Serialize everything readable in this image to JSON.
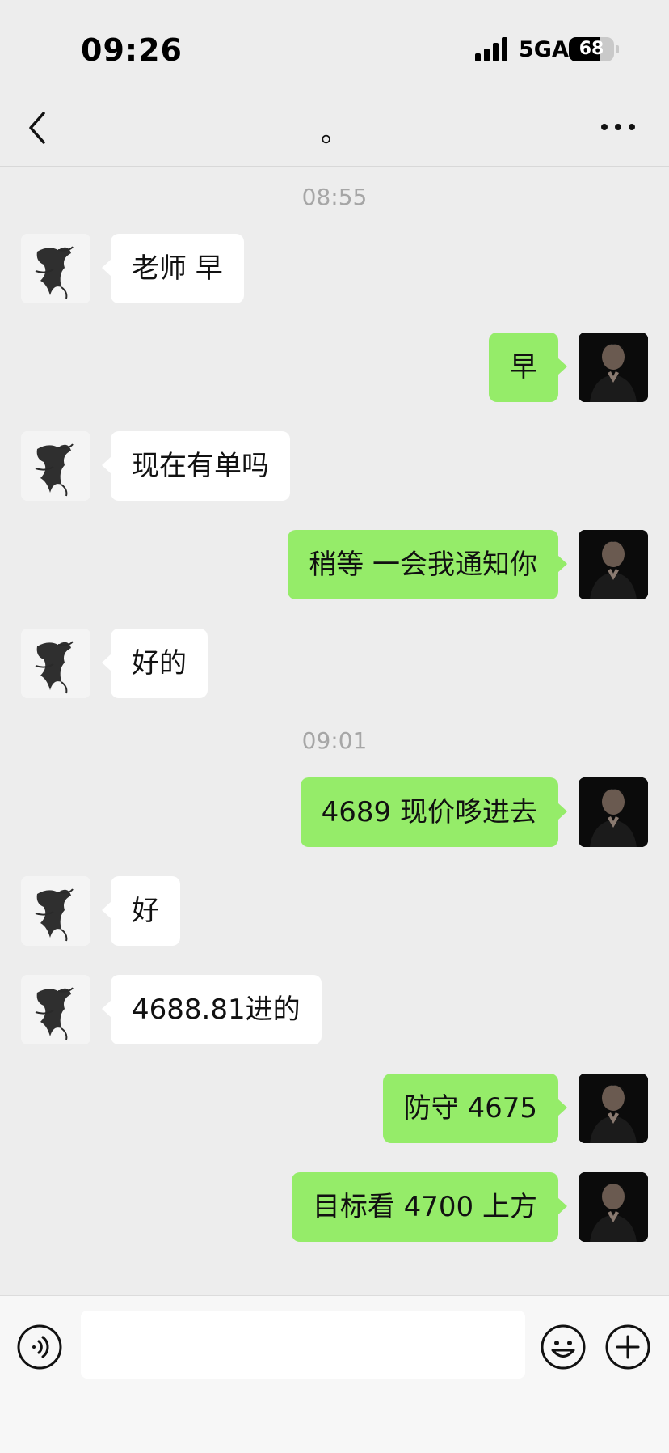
{
  "status_bar": {
    "time": "09:26",
    "network": "5GA",
    "battery": "68",
    "battery_level": 0.68
  },
  "header": {
    "title": "。",
    "icons": {
      "back": "chevron-left-icon",
      "more": "more-dots-icon"
    }
  },
  "messages": [
    {
      "type": "timestamp",
      "text": "08:55"
    },
    {
      "type": "message",
      "side": "left",
      "text": "老师 早"
    },
    {
      "type": "message",
      "side": "right",
      "text": "早"
    },
    {
      "type": "message",
      "side": "left",
      "text": "现在有单吗"
    },
    {
      "type": "message",
      "side": "right",
      "text": "稍等 一会我通知你"
    },
    {
      "type": "message",
      "side": "left",
      "text": "好的"
    },
    {
      "type": "timestamp",
      "text": "09:01"
    },
    {
      "type": "message",
      "side": "right",
      "text": "4689 现价哆进去"
    },
    {
      "type": "message",
      "side": "left",
      "text": "好"
    },
    {
      "type": "message",
      "side": "left",
      "text": "4688.81进的"
    },
    {
      "type": "message",
      "side": "right",
      "text": "防守 4675"
    },
    {
      "type": "message",
      "side": "right",
      "text": "目标看 4700 上方"
    }
  ],
  "input_bar": {
    "value": "",
    "icons": {
      "voice": "voice-icon",
      "emoji": "emoji-icon",
      "plus": "plus-icon"
    }
  },
  "colors": {
    "background": "#ededed",
    "bubble_sent": "#95ec69",
    "bubble_received": "#ffffff",
    "timestamp": "#a6a6a6"
  }
}
